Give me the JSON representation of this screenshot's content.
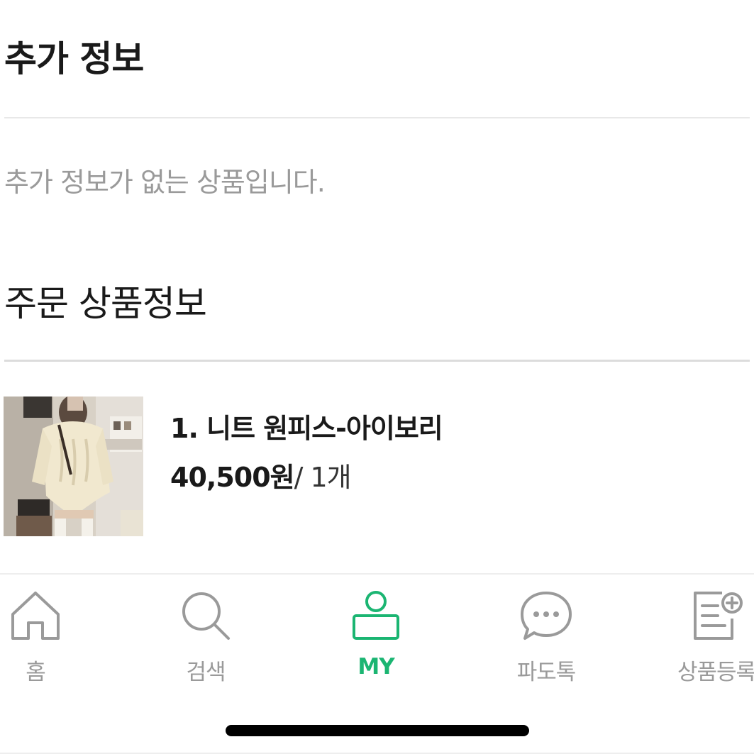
{
  "extra_info": {
    "title": "추가 정보",
    "empty_message": "추가 정보가 없는 상품입니다."
  },
  "order_products": {
    "title": "주문 상품정보",
    "items": [
      {
        "name": "1. 니트 원피스-아이보리",
        "price": "40,500원",
        "quantity": "/ 1개"
      }
    ]
  },
  "tabbar": {
    "active_color": "#1bb572",
    "inactive_color": "#9a9a9a",
    "tabs": [
      {
        "label": "홈",
        "icon": "home-icon"
      },
      {
        "label": "검색",
        "icon": "search-icon"
      },
      {
        "label": "MY",
        "icon": "user-icon",
        "active": true
      },
      {
        "label": "파도톡",
        "icon": "chat-icon"
      },
      {
        "label": "상품등록",
        "icon": "register-product-icon"
      }
    ]
  }
}
